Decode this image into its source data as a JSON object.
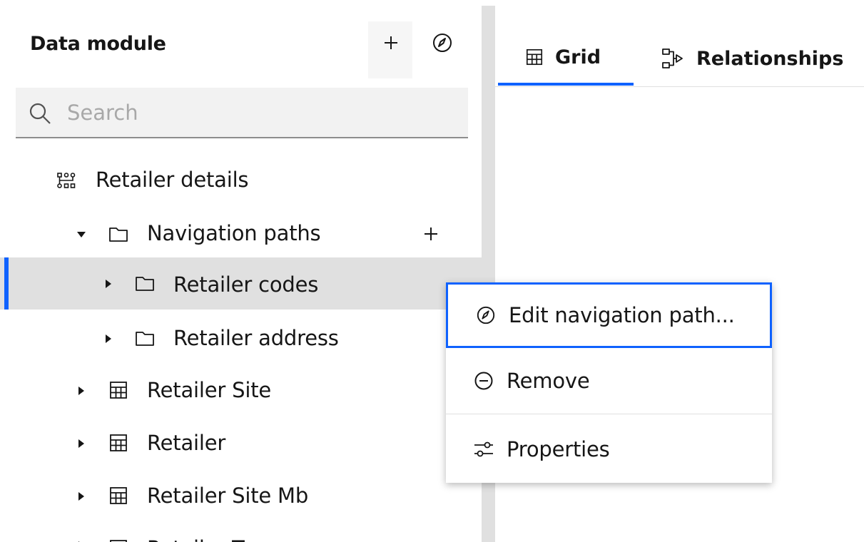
{
  "sidebar": {
    "title": "Data module",
    "search_placeholder": "Search",
    "tree": [
      {
        "label": "Retailer details",
        "icon": "data-module-icon",
        "expanded": false
      },
      {
        "label": "Navigation paths",
        "icon": "folder-icon",
        "expanded": true
      },
      {
        "label": "Retailer codes",
        "icon": "folder-icon",
        "selected": true
      },
      {
        "label": "Retailer address",
        "icon": "folder-icon"
      },
      {
        "label": "Retailer Site",
        "icon": "table-icon"
      },
      {
        "label": "Retailer",
        "icon": "table-icon"
      },
      {
        "label": "Retailer Site Mb",
        "icon": "table-icon"
      },
      {
        "label": "Retailer Ty...",
        "icon": "table-icon"
      }
    ]
  },
  "tabs": [
    {
      "label": "Grid",
      "icon": "grid-icon",
      "active": true
    },
    {
      "label": "Relationships",
      "icon": "relationships-icon",
      "active": false
    }
  ],
  "context_menu": {
    "items": [
      {
        "label": "Edit navigation path...",
        "icon": "edit-navigation-icon",
        "focused": true
      },
      {
        "label": "Remove",
        "icon": "remove-icon"
      },
      {
        "label": "Properties",
        "icon": "properties-icon"
      }
    ]
  },
  "colors": {
    "accent": "#0f62fe",
    "selected_row": "#e0e0e0",
    "search_bg": "#f2f2f2",
    "text": "#161616"
  }
}
